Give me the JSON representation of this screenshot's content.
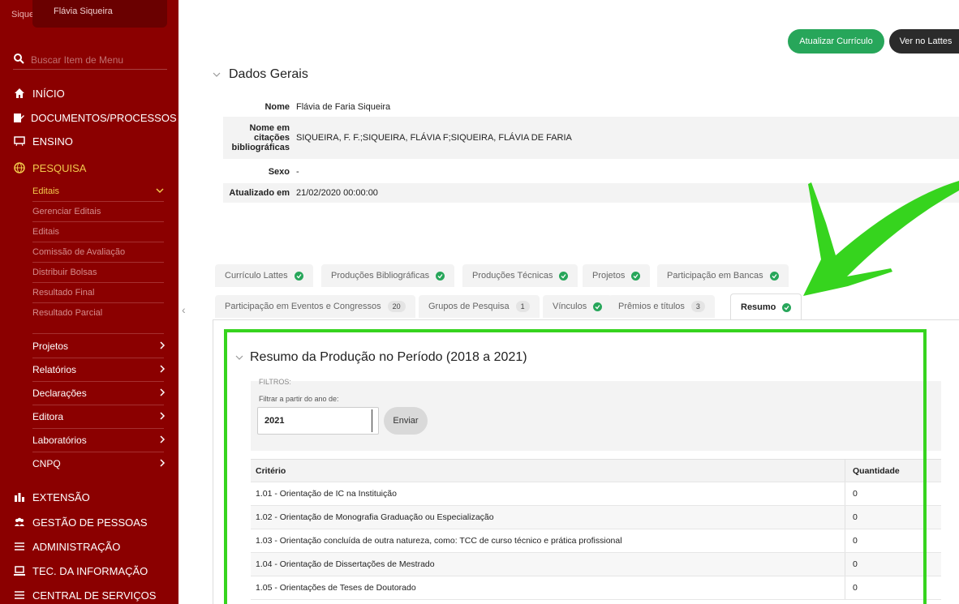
{
  "user": {
    "prefix": "Siqueir",
    "name": "Flávia Siqueira"
  },
  "search": {
    "placeholder": "Buscar Item de Menu"
  },
  "nav": {
    "inicio": "INÍCIO",
    "documentos": "DOCUMENTOS/PROCESSOS",
    "ensino": "ENSINO",
    "pesquisa": "PESQUISA",
    "extensao": "EXTENSÃO",
    "gestao": "GESTÃO DE PESSOAS",
    "administracao": "ADMINISTRAÇÃO",
    "tec": "TEC. DA INFORMAÇÃO",
    "central": "CENTRAL DE SERVIÇOS"
  },
  "pesquisa_sub": {
    "editais": "Editais",
    "items": [
      "Gerenciar Editais",
      "Editais",
      "Comissão de Avaliação",
      "Distribuir Bolsas",
      "Resultado Final",
      "Resultado Parcial"
    ],
    "groups": [
      "Projetos",
      "Relatórios",
      "Declarações",
      "Editora",
      "Laboratórios",
      "CNPQ"
    ]
  },
  "buttons": {
    "update": "Atualizar Currículo",
    "lattes": "Ver no Lattes"
  },
  "dados": {
    "title": "Dados Gerais",
    "rows": [
      {
        "label": "Nome",
        "value": "Flávia de Faria Siqueira"
      },
      {
        "label": "Nome em citações bibliográficas",
        "value": "SIQUEIRA, F. F.;SIQUEIRA, FLÁVIA F;SIQUEIRA, FLÁVIA DE FARIA"
      },
      {
        "label": "Sexo",
        "value": "-"
      },
      {
        "label": "Atualizado em",
        "value": "21/02/2020 00:00:00"
      }
    ]
  },
  "tabs": {
    "row1": [
      "Currículo Lattes",
      "Produções Bibliográficas",
      "Produções Técnicas",
      "Projetos",
      "Participação em Bancas"
    ],
    "row2": [
      {
        "label": "Participação em Eventos e Congressos",
        "count": "20"
      },
      {
        "label": "Grupos de Pesquisa",
        "count": "1"
      },
      {
        "label": "Vínculos",
        "count": ""
      },
      {
        "label": "Prêmios e títulos",
        "count": "3"
      },
      {
        "label": "Resumo",
        "count": ""
      }
    ]
  },
  "resumo": {
    "title": "Resumo da Produção no Período (2018 a 2021)",
    "filters_label": "FILTROS:",
    "filter_sub": "Filtrar a partir do ano de:",
    "year": "2021",
    "submit": "Enviar",
    "col_criterio": "Critério",
    "col_quantidade": "Quantidade",
    "rows": [
      {
        "criterio": "1.01 - Orientação de IC na Instituição",
        "quantidade": "0"
      },
      {
        "criterio": "1.02 - Orientação de Monografia Graduação ou Especialização",
        "quantidade": "0"
      },
      {
        "criterio": "1.03 - Orientação concluída de outra natureza, como: TCC de curso técnico e prática profissional",
        "quantidade": "0"
      },
      {
        "criterio": "1.04 - Orientação de Dissertações de Mestrado",
        "quantidade": "0"
      },
      {
        "criterio": "1.05 - Orientações de Teses de Doutorado",
        "quantidade": "0"
      }
    ]
  },
  "colors": {
    "sidebar": "#8b0000",
    "accent": "#f2c94c",
    "green": "#27a65a",
    "highlight": "#36d41e"
  }
}
